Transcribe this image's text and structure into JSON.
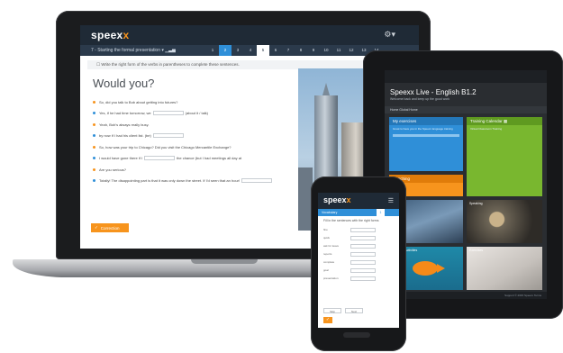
{
  "laptop": {
    "logo_main": "speex",
    "logo_x": "x",
    "gear_icon": "gear-icon",
    "lesson_title": "7 - Starting the formal presentation",
    "steps": [
      "1",
      "2",
      "3",
      "4",
      "5",
      "6",
      "7",
      "8",
      "9",
      "10",
      "11",
      "12",
      "13",
      "14"
    ],
    "active_step": 1,
    "current_step": 4,
    "instruction": "Write the right form of the verbs in parentheses to complete these sentences.",
    "heading": "Would you?",
    "sentences": [
      "So, did you talk to Bob about getting into futures?",
      "Yes, if he had time tomorrow, we",
      "Yeah, Bob's always really busy.",
      "by now if I had his client list. (be)",
      "So, how was your trip to Chicago? Did you visit the Chicago Mercantile Exchange?",
      "I would have gone there if I",
      "Are you serious?",
      "Totally! The disappointing part is that it was only down the street. If I'd seen that an hour!"
    ],
    "sentence_suffixes": [
      "",
      "(about it / talk)",
      "",
      "",
      "",
      "the chance (but I had meetings all day at",
      "",
      ""
    ],
    "correction_button": "Correction",
    "check_icon": "check-icon"
  },
  "tablet": {
    "title": "Speexx Live - English B1.2",
    "subtitle": "Welcome back and keep up the good work",
    "menu": "Home   Global Home",
    "tiles": {
      "exercises": {
        "title": "My exercises",
        "body": "Great to have you in the Speexx language training"
      },
      "calendar": {
        "title": "Training Calendar",
        "body": "Virtual Classroom Training"
      },
      "coaching": {
        "title": "Coaching"
      }
    },
    "photo_labels": [
      "Pictures",
      "Speaking",
      "Learning Activities",
      "Exercises"
    ],
    "footer": "Support  © 2015 Speexx  Terms"
  },
  "phone": {
    "logo_main": "speex",
    "logo_x": "x",
    "burger_icon": "menu-icon",
    "bar_label": "Vocabulary",
    "page": "1",
    "instruction": "Fill in the sentences with the right forms",
    "fields": [
      "fine",
      "quick",
      "ask for leave",
      "reports",
      "complete",
      "goal",
      "presentation"
    ],
    "keys": [
      "Skip",
      "Next"
    ],
    "ok_label": "✓"
  },
  "colors": {
    "accent_orange": "#f7941d",
    "accent_blue": "#2f8fd8",
    "accent_green": "#79b72f",
    "header_dark": "#1f2a36"
  }
}
